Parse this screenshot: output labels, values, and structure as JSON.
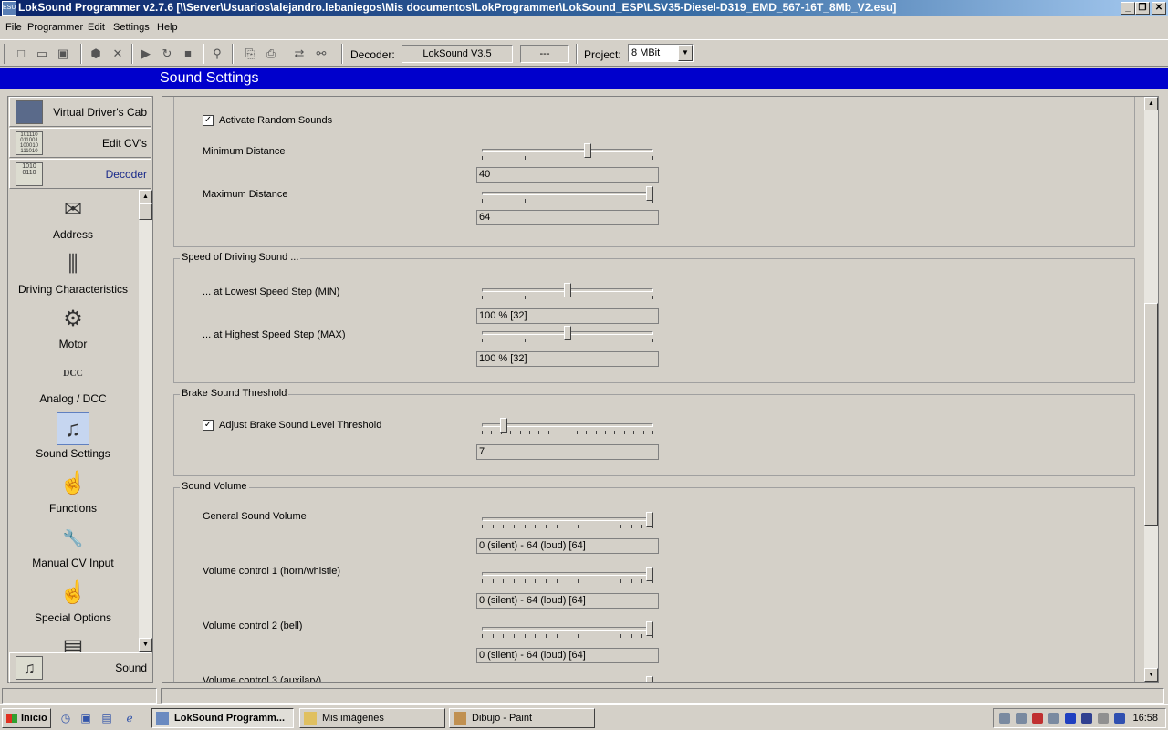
{
  "window": {
    "app_icon": "ESU",
    "title": "LokSound Programmer  v2.7.6  [\\\\Server\\Usuarios\\alejandro.lebaniegos\\Mis documentos\\LokProgrammer\\LokSound_ESP\\LSV35-Diesel-D319_EMD_567-16T_8Mb_V2.esu]",
    "btn_min": "_",
    "btn_max": "❐",
    "btn_close": "✕"
  },
  "menu": [
    "File",
    "Programmer",
    "Edit",
    "Settings",
    "Help"
  ],
  "toolbar": {
    "decoder_label": "Decoder:",
    "decoder_value": "LokSound V3.5",
    "decoder_extra": "---",
    "project_label": "Project:",
    "project_value": "8 MBit"
  },
  "section_title": "Sound Settings",
  "sidebar": {
    "top_buttons": [
      {
        "label": "Virtual Driver's Cab",
        "icon": "cab-icon"
      },
      {
        "label": "Edit CV's",
        "icon": "binary-icon",
        "glyph": "101110\n011001\n100010\n111010"
      },
      {
        "label": "Decoder",
        "icon": "decoder-icon",
        "glyph": "1010\n0110"
      }
    ],
    "items": [
      {
        "label": "Address",
        "icon": "envelope-icon",
        "glyph": "✉"
      },
      {
        "label": "Driving Characteristics",
        "icon": "sliders-icon",
        "glyph": "⫼"
      },
      {
        "label": "Motor",
        "icon": "motor-icon",
        "glyph": "⚙"
      },
      {
        "label": "Analog / DCC",
        "icon": "meter-icon",
        "glyph": "DCC"
      },
      {
        "label": "Sound Settings",
        "icon": "music-sliders-icon",
        "glyph": "♫"
      },
      {
        "label": "Functions",
        "icon": "hand-keys-icon",
        "glyph": "☝"
      },
      {
        "label": "Manual CV Input",
        "icon": "wrench-icon",
        "glyph": "🔧"
      },
      {
        "label": "Special Options",
        "icon": "hand-keys-icon",
        "glyph": "☝"
      },
      {
        "label": "",
        "icon": "card-icon",
        "glyph": "▤"
      }
    ],
    "bottom_button": {
      "label": "Sound",
      "icon": "music-notes-icon",
      "glyph": "♫"
    }
  },
  "content": {
    "random": {
      "checkbox_label": "Activate Random Sounds",
      "checked": true,
      "min_label": "Minimum Distance",
      "min_value": "40",
      "min_level": 0.62,
      "max_label": "Maximum Distance",
      "max_value": "64",
      "max_level": 1.0
    },
    "speed": {
      "title": "Speed of Driving Sound ...",
      "low_label": "... at Lowest Speed Step (MIN)",
      "low_value": "100 %  [32]",
      "low_level": 0.5,
      "high_label": "... at Highest Speed Step (MAX)",
      "high_value": "100 %  [32]",
      "high_level": 0.5
    },
    "brake": {
      "title": "Brake Sound Threshold",
      "checkbox_label": "Adjust Brake Sound Level Threshold",
      "checked": true,
      "value": "7",
      "level": 0.11
    },
    "volume": {
      "title": "Sound Volume",
      "rows": [
        {
          "label": "General Sound Volume",
          "value": "0 (silent) - 64 (loud)  [64]",
          "level": 1.0
        },
        {
          "label": "Volume control 1 (horn/whistle)",
          "value": "0 (silent) - 64 (loud)  [64]",
          "level": 1.0
        },
        {
          "label": "Volume control 2 (bell)",
          "value": "0 (silent) - 64 (loud)  [64]",
          "level": 1.0
        },
        {
          "label": "Volume control 3 (auxilary)",
          "value": "",
          "level": 1.0
        }
      ]
    }
  },
  "taskbar": {
    "start": "Inicio",
    "tasks": [
      {
        "label": "LokSound Programm...",
        "active": true
      },
      {
        "label": "Mis imágenes",
        "active": false
      },
      {
        "label": "Dibujo - Paint",
        "active": false
      }
    ],
    "clock": "16:58"
  }
}
